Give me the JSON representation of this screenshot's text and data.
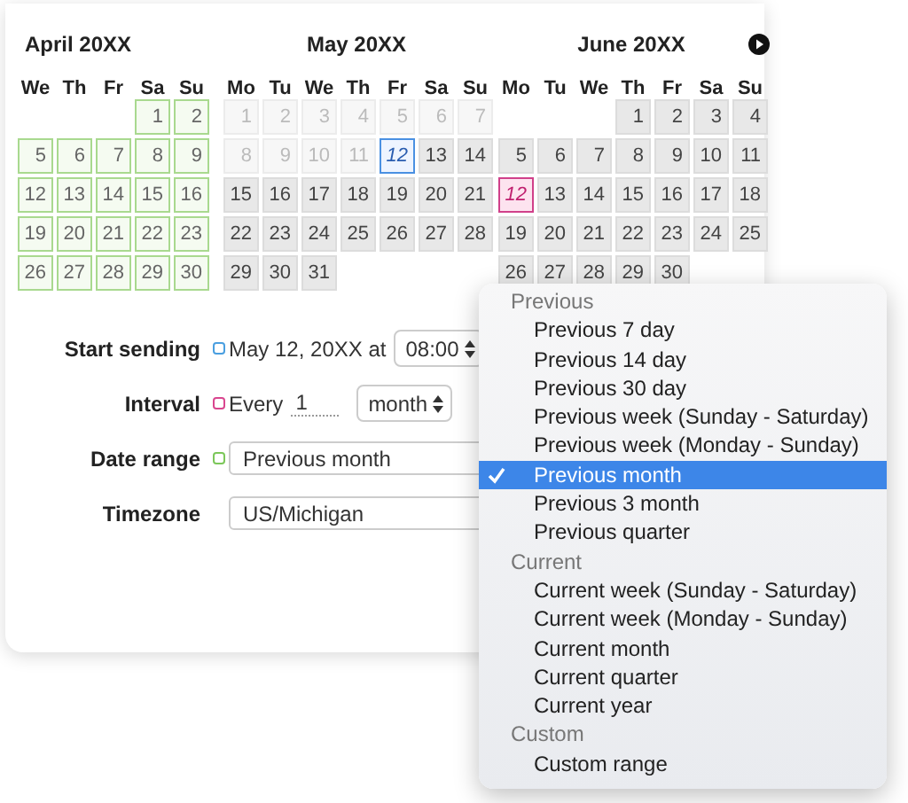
{
  "calendars": [
    {
      "title": "April 20XX",
      "weekdays": [
        "We",
        "Th",
        "Fr",
        "Sa",
        "Su"
      ],
      "weeks": [
        [
          {
            "day": "1",
            "kind": "range"
          },
          {
            "day": "2",
            "kind": "range"
          }
        ],
        [
          {
            "day": "5",
            "kind": "range"
          },
          {
            "day": "6",
            "kind": "range"
          },
          {
            "day": "7",
            "kind": "range"
          },
          {
            "day": "8",
            "kind": "range"
          },
          {
            "day": "9",
            "kind": "range"
          }
        ],
        [
          {
            "day": "12",
            "kind": "range"
          },
          {
            "day": "13",
            "kind": "range"
          },
          {
            "day": "14",
            "kind": "range"
          },
          {
            "day": "15",
            "kind": "range"
          },
          {
            "day": "16",
            "kind": "range"
          }
        ],
        [
          {
            "day": "19",
            "kind": "range"
          },
          {
            "day": "20",
            "kind": "range"
          },
          {
            "day": "21",
            "kind": "range"
          },
          {
            "day": "22",
            "kind": "range"
          },
          {
            "day": "23",
            "kind": "range"
          }
        ],
        [
          {
            "day": "26",
            "kind": "range"
          },
          {
            "day": "27",
            "kind": "range"
          },
          {
            "day": "28",
            "kind": "range"
          },
          {
            "day": "29",
            "kind": "range"
          },
          {
            "day": "30",
            "kind": "range"
          }
        ]
      ]
    },
    {
      "title": "May 20XX",
      "weekdays": [
        "Mo",
        "Tu",
        "We",
        "Th",
        "Fr",
        "Sa",
        "Su"
      ],
      "weeks": [
        [
          {
            "day": "1",
            "kind": "past"
          },
          {
            "day": "2",
            "kind": "past"
          },
          {
            "day": "3",
            "kind": "past"
          },
          {
            "day": "4",
            "kind": "past"
          },
          {
            "day": "5",
            "kind": "past"
          },
          {
            "day": "6",
            "kind": "past"
          },
          {
            "day": "7",
            "kind": "past"
          }
        ],
        [
          {
            "day": "8",
            "kind": "past"
          },
          {
            "day": "9",
            "kind": "past"
          },
          {
            "day": "10",
            "kind": "past"
          },
          {
            "day": "11",
            "kind": "past"
          },
          {
            "day": "12",
            "kind": "start"
          },
          {
            "day": "13",
            "kind": "normal"
          },
          {
            "day": "14",
            "kind": "normal"
          }
        ],
        [
          {
            "day": "15",
            "kind": "normal"
          },
          {
            "day": "16",
            "kind": "normal"
          },
          {
            "day": "17",
            "kind": "normal"
          },
          {
            "day": "18",
            "kind": "normal"
          },
          {
            "day": "19",
            "kind": "normal"
          },
          {
            "day": "20",
            "kind": "normal"
          },
          {
            "day": "21",
            "kind": "normal"
          }
        ],
        [
          {
            "day": "22",
            "kind": "normal"
          },
          {
            "day": "23",
            "kind": "normal"
          },
          {
            "day": "24",
            "kind": "normal"
          },
          {
            "day": "25",
            "kind": "normal"
          },
          {
            "day": "26",
            "kind": "normal"
          },
          {
            "day": "27",
            "kind": "normal"
          },
          {
            "day": "28",
            "kind": "normal"
          }
        ],
        [
          {
            "day": "29",
            "kind": "normal"
          },
          {
            "day": "30",
            "kind": "normal"
          },
          {
            "day": "31",
            "kind": "normal"
          }
        ]
      ]
    },
    {
      "title": "June 20XX",
      "weekdays": [
        "Mo",
        "Tu",
        "We",
        "Th",
        "Fr",
        "Sa",
        "Su"
      ],
      "weeks": [
        [
          {
            "day": "1",
            "kind": "normal"
          },
          {
            "day": "2",
            "kind": "normal"
          },
          {
            "day": "3",
            "kind": "normal"
          },
          {
            "day": "4",
            "kind": "normal"
          }
        ],
        [
          {
            "day": "5",
            "kind": "normal"
          },
          {
            "day": "6",
            "kind": "normal"
          },
          {
            "day": "7",
            "kind": "normal"
          },
          {
            "day": "8",
            "kind": "normal"
          },
          {
            "day": "9",
            "kind": "normal"
          },
          {
            "day": "10",
            "kind": "normal"
          },
          {
            "day": "11",
            "kind": "normal"
          }
        ],
        [
          {
            "day": "12",
            "kind": "next"
          },
          {
            "day": "13",
            "kind": "normal"
          },
          {
            "day": "14",
            "kind": "normal"
          },
          {
            "day": "15",
            "kind": "normal"
          },
          {
            "day": "16",
            "kind": "normal"
          },
          {
            "day": "17",
            "kind": "normal"
          },
          {
            "day": "18",
            "kind": "normal"
          }
        ],
        [
          {
            "day": "19",
            "kind": "normal"
          },
          {
            "day": "20",
            "kind": "normal"
          },
          {
            "day": "21",
            "kind": "normal"
          },
          {
            "day": "22",
            "kind": "normal"
          },
          {
            "day": "23",
            "kind": "normal"
          },
          {
            "day": "24",
            "kind": "normal"
          },
          {
            "day": "25",
            "kind": "normal"
          }
        ],
        [
          {
            "day": "26",
            "kind": "normal"
          },
          {
            "day": "27",
            "kind": "normal"
          },
          {
            "day": "28",
            "kind": "normal"
          },
          {
            "day": "29",
            "kind": "normal"
          },
          {
            "day": "30",
            "kind": "normal"
          }
        ]
      ]
    }
  ],
  "form": {
    "start_sending": {
      "label": "Start sending",
      "color": "#4a9fe0",
      "date": "May 12, 20XX at",
      "time": "08:00"
    },
    "interval": {
      "label": "Interval",
      "color": "#d9468f",
      "prefix": "Every",
      "count": "1",
      "unit": "month"
    },
    "date_range": {
      "label": "Date range",
      "color": "#7cc75a",
      "value": "Previous month"
    },
    "timezone": {
      "label": "Timezone",
      "value": "US/Michigan"
    }
  },
  "date_range_menu": [
    {
      "header": "Previous",
      "items": [
        {
          "label": "Previous 7 day",
          "selected": false
        },
        {
          "label": "Previous 14 day",
          "selected": false
        },
        {
          "label": "Previous 30 day",
          "selected": false
        },
        {
          "label": "Previous week (Sunday - Saturday)",
          "selected": false
        },
        {
          "label": "Previous week (Monday - Sunday)",
          "selected": false
        },
        {
          "label": "Previous month",
          "selected": true
        },
        {
          "label": "Previous 3 month",
          "selected": false
        },
        {
          "label": "Previous quarter",
          "selected": false
        }
      ]
    },
    {
      "header": "Current",
      "items": [
        {
          "label": "Current week (Sunday - Saturday)",
          "selected": false
        },
        {
          "label": "Current week (Monday - Sunday)",
          "selected": false
        },
        {
          "label": "Current month",
          "selected": false
        },
        {
          "label": "Current quarter",
          "selected": false
        },
        {
          "label": "Current year",
          "selected": false
        }
      ]
    },
    {
      "header": "Custom",
      "items": [
        {
          "label": "Custom range",
          "selected": false
        }
      ]
    }
  ]
}
